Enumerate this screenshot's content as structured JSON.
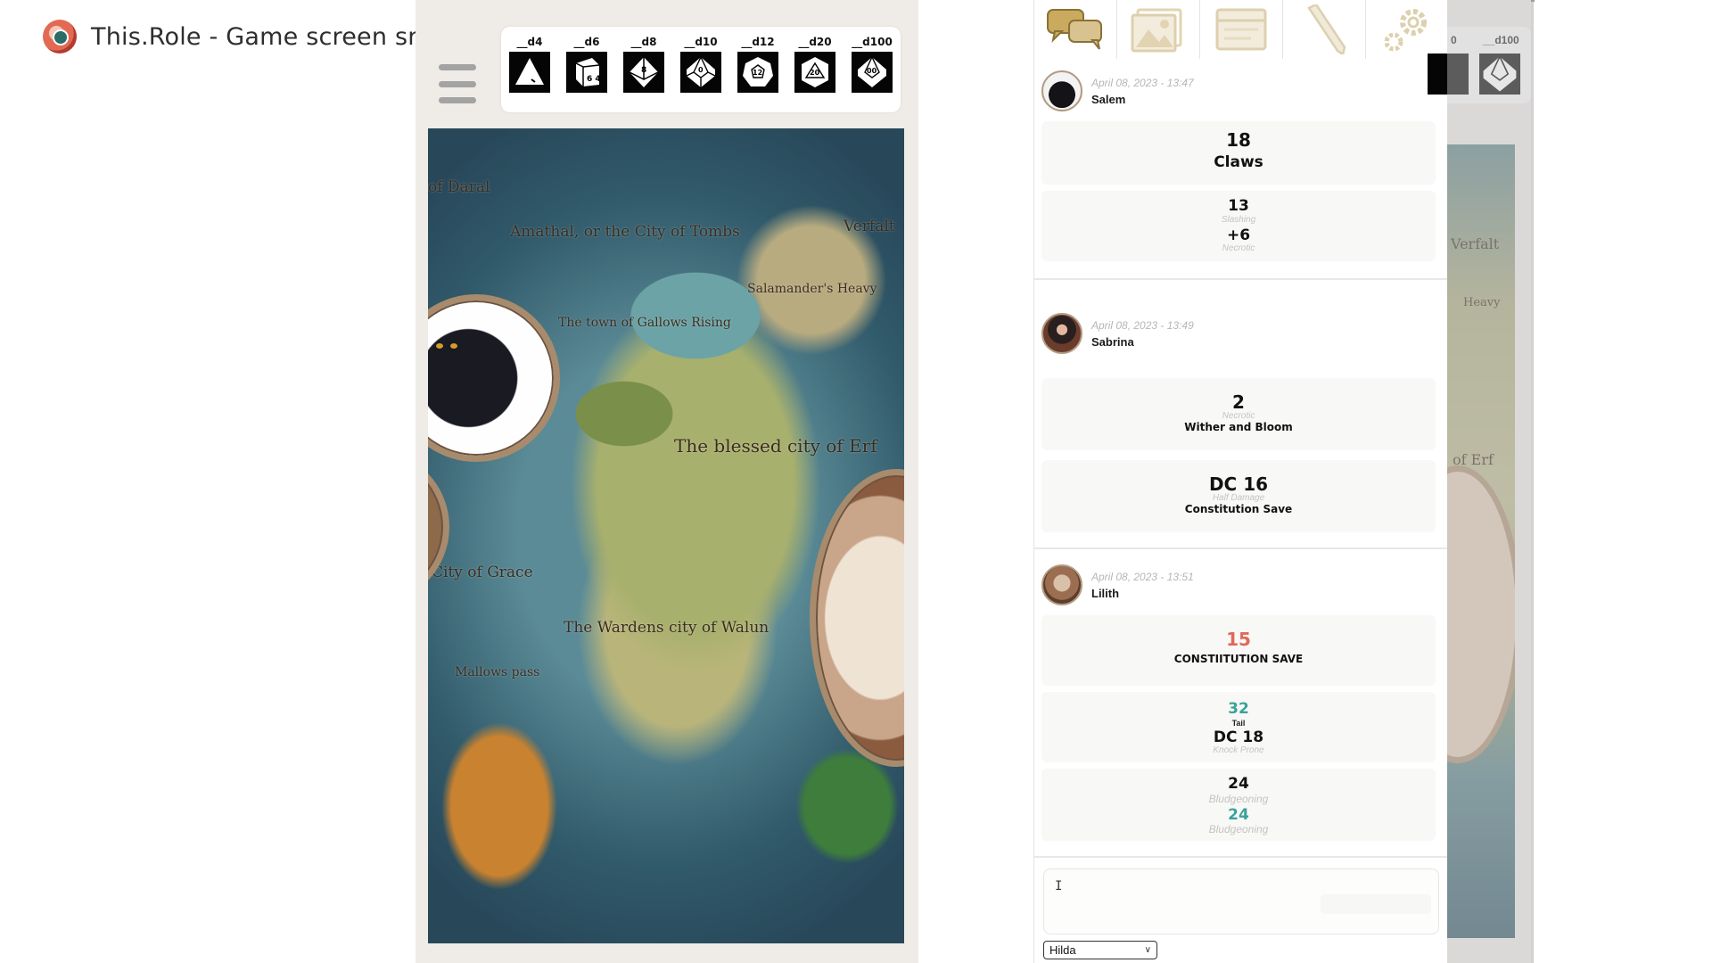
{
  "app": {
    "title": "This.Role - Game screen sm"
  },
  "dice": [
    {
      "label": "__d4",
      "icon": "d4-icon",
      "face": ""
    },
    {
      "label": "__d6",
      "icon": "d6-icon",
      "face": "6 4"
    },
    {
      "label": "__d8",
      "icon": "d8-icon",
      "face": "8"
    },
    {
      "label": "__d10",
      "icon": "d10-icon",
      "face": "0"
    },
    {
      "label": "__d12",
      "icon": "d12-icon",
      "face": "12"
    },
    {
      "label": "__d20",
      "icon": "d20-icon",
      "face": "20"
    },
    {
      "label": "__d100",
      "icon": "d100-icon",
      "face": "00"
    }
  ],
  "map": {
    "labels": [
      {
        "text": "of Daral"
      },
      {
        "text": "Amathal, or the City of Tombs"
      },
      {
        "text": "Verfalt"
      },
      {
        "text": "Salamander's Heavy"
      },
      {
        "text": "The town of Gallows Rising"
      },
      {
        "text": "The blessed city of Erf"
      },
      {
        "text": "City of Grace"
      },
      {
        "text": "The Wardens city of Walun"
      },
      {
        "text": "Mallows pass"
      }
    ]
  },
  "chat": {
    "tabs": [
      {
        "name": "chat",
        "icon": "chat-bubbles-icon"
      },
      {
        "name": "images",
        "icon": "image-icon"
      },
      {
        "name": "cards",
        "icon": "cards-icon"
      },
      {
        "name": "notes",
        "icon": "pencil-icon"
      },
      {
        "name": "settings",
        "icon": "gears-icon"
      }
    ],
    "messages": [
      {
        "time": "April 08, 2023 - 13:47",
        "user": "Salem",
        "rolls": [
          {
            "value": "18",
            "name": "Claws"
          },
          {
            "value1": "13",
            "sub1": "Slashing",
            "value2": "+6",
            "sub2": "Necrotic"
          }
        ]
      },
      {
        "time": "April 08, 2023 - 13:49",
        "user": "Sabrina",
        "rolls": [
          {
            "value": "2",
            "sub": "Necrotic",
            "caption": "Wither and Bloom"
          },
          {
            "value": "DC 16",
            "sub": "Half Damage",
            "caption": "Constitution Save"
          }
        ]
      },
      {
        "time": "April 08, 2023 - 13:51",
        "user": "Lilith",
        "rolls": [
          {
            "value": "15",
            "caption": "CONSTIITUTION SAVE"
          },
          {
            "value1": "32",
            "label1": "Tail",
            "value2": "DC 18",
            "sub2": "Knock Prone"
          },
          {
            "value1": "24",
            "sub1": "Bludgeoning",
            "value2": "24",
            "sub2": "Bludgeoning"
          }
        ]
      }
    ],
    "input": {
      "value": "",
      "cursor": "I"
    },
    "character_select": {
      "selected": "Hilda"
    }
  },
  "partial": {
    "dice_labels": [
      "0",
      "__d100"
    ],
    "map_labels": [
      "Verfalt",
      "Heavy",
      "of Erf"
    ]
  },
  "colors": {
    "accent_tan": "#a88b6d",
    "icon_gold": "#d8c28f",
    "crit_red": "#e0685a",
    "teal": "#38a39a"
  }
}
